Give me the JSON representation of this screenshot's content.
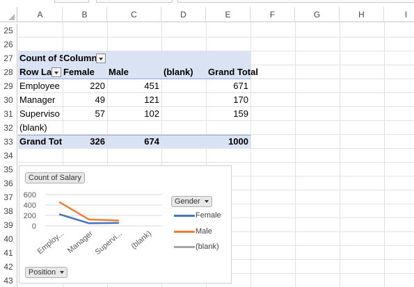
{
  "columns": [
    "A",
    "B",
    "C",
    "D",
    "E",
    "F",
    "G",
    "H",
    "I"
  ],
  "rows": [
    "25",
    "26",
    "27",
    "28",
    "29",
    "30",
    "31",
    "32",
    "33",
    "34",
    "35",
    "36",
    "37",
    "38",
    "39",
    "40",
    "41",
    "42",
    "43"
  ],
  "pivot": {
    "header_row1": {
      "a": "Count of S",
      "b": "Column"
    },
    "header_row2": {
      "a": "Row La",
      "b": "Female",
      "c": "Male",
      "d": "(blank)",
      "e": "Grand Total"
    },
    "body": [
      {
        "label": "Employee",
        "female": "220",
        "male": "451",
        "blank": "",
        "total": "671"
      },
      {
        "label": "Manager",
        "female": "49",
        "male": "121",
        "blank": "",
        "total": "170"
      },
      {
        "label": "Superviso",
        "female": "57",
        "male": "102",
        "blank": "",
        "total": "159"
      },
      {
        "label": "(blank)",
        "female": "",
        "male": "",
        "blank": "",
        "total": ""
      }
    ],
    "grand_total": {
      "label": "Grand Tot",
      "female": "326",
      "male": "674",
      "blank": "",
      "total": "1000"
    }
  },
  "chart": {
    "value_field": "Count of Salary",
    "axis_field": "Position",
    "legend_field": "Gender",
    "y_ticks": [
      "600",
      "400",
      "200",
      "0"
    ],
    "x_labels": [
      "Employ...",
      "Manager",
      "Supervi...",
      "(blank)"
    ],
    "legend": [
      {
        "name": "Female",
        "color": "#4472c4"
      },
      {
        "name": "Male",
        "color": "#ed7d31"
      },
      {
        "name": "(blank)",
        "color": "#a5a5a5"
      }
    ]
  },
  "chart_data": {
    "type": "line",
    "categories": [
      "Employee",
      "Manager",
      "Supervisor",
      "(blank)"
    ],
    "series": [
      {
        "name": "Female",
        "values": [
          220,
          49,
          57,
          null
        ]
      },
      {
        "name": "Male",
        "values": [
          451,
          121,
          102,
          null
        ]
      },
      {
        "name": "(blank)",
        "values": [
          null,
          null,
          null,
          null
        ]
      }
    ],
    "ylim": [
      0,
      600
    ],
    "ylabel": "",
    "xlabel": "",
    "grid": true,
    "legend": "right"
  }
}
